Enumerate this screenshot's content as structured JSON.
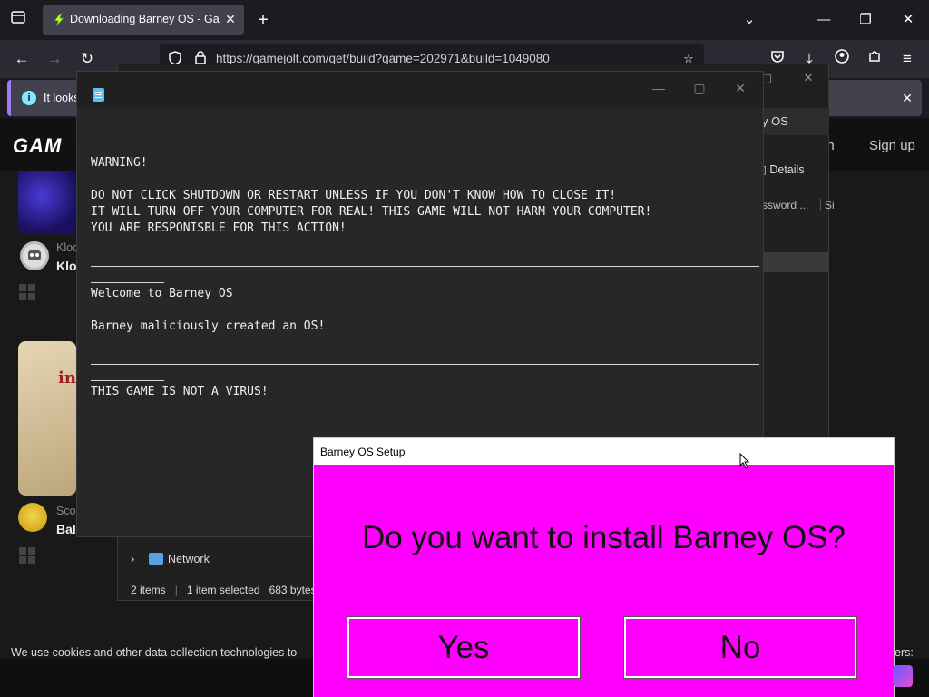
{
  "browser": {
    "tab_title": "Downloading Barney OS - Game Jolt",
    "url": "https://gamejolt.com/get/build?game=202971&build=1049080",
    "infobar_text": "It looks"
  },
  "page": {
    "logo": "GAM",
    "sign_in": "in",
    "sign_up": "Sign up",
    "users": [
      {
        "small": "Kloo",
        "big": "Klo"
      },
      {
        "small": "Sco",
        "big": "Bal"
      }
    ],
    "thumb_text": "in",
    "cookie_text": "We use cookies and other data collection technologies to",
    "cookie_tail": "ers:"
  },
  "explorer": {
    "search_text": "y OS",
    "details_label": "Details",
    "column_password": "ssword ...",
    "column_size": "Si",
    "network_label": "Network",
    "status_items": "2 items",
    "status_selected": "1 item selected",
    "status_size": "683 bytes"
  },
  "notepad": {
    "lines": [
      "WARNING!",
      "DO NOT CLICK SHUTDOWN OR RESTART UNLESS IF YOU DON'T KNOW HOW TO CLOSE IT!",
      "IT WILL TURN OFF YOUR COMPUTER FOR REAL! THIS GAME WILL NOT HARM YOUR COMPUTER!",
      "YOU ARE RESPONISBLE FOR THIS ACTION!",
      "Welcome to Barney OS",
      "Barney maliciously created an OS!",
      "THIS GAME IS NOT A VIRUS!"
    ]
  },
  "setup": {
    "title": "Barney OS Setup",
    "question": "Do you want to install Barney OS?",
    "yes_label": "Yes",
    "no_label": "No",
    "background_color": "#ff00ff"
  },
  "icons": [
    "tab-list-icon",
    "gamejolt-favicon-icon",
    "close-icon",
    "plus-icon",
    "chevron-down-icon",
    "minimize-icon",
    "restore-icon",
    "back-arrow-icon",
    "forward-arrow-icon",
    "reload-icon",
    "shield-icon",
    "lock-icon",
    "star-icon",
    "pocket-icon",
    "download-icon",
    "account-icon",
    "extensions-icon",
    "menu-icon",
    "info-icon",
    "notepad-icon",
    "network-icon",
    "mouse-cursor-icon"
  ]
}
